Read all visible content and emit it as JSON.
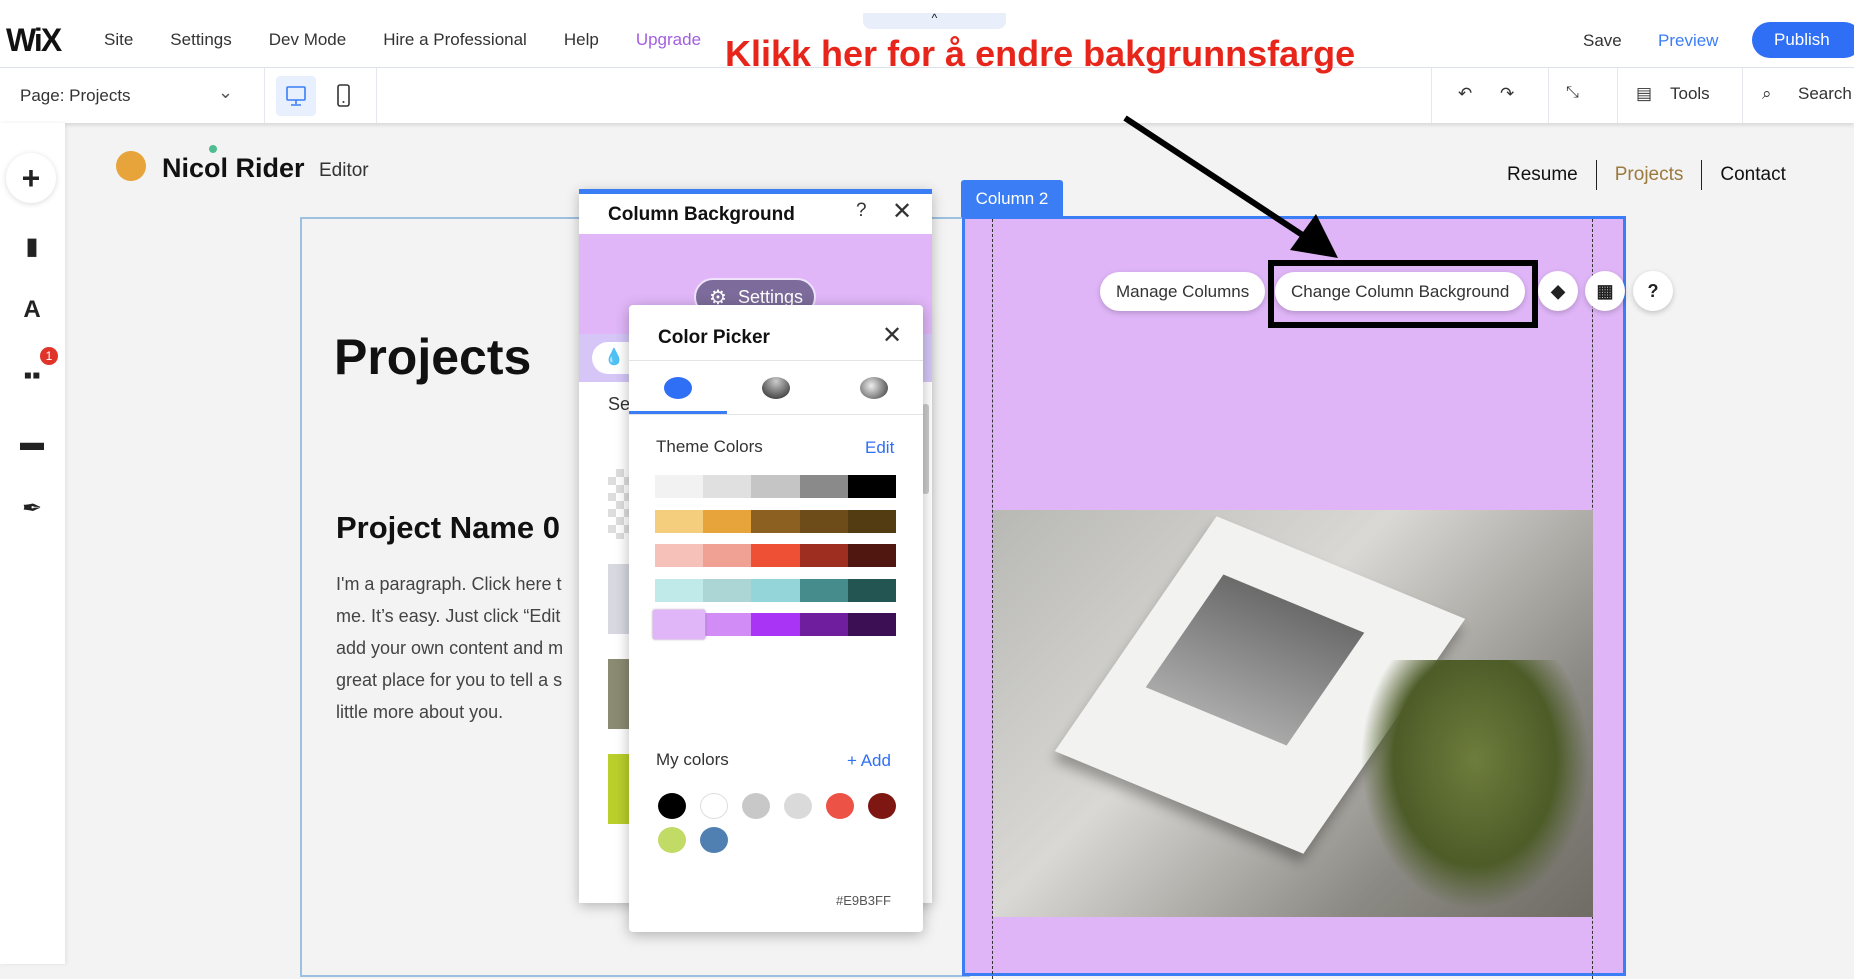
{
  "topbar": {
    "logo": "WiX",
    "menu": [
      "Site",
      "Settings",
      "Dev Mode",
      "Hire a Professional",
      "Help",
      "Upgrade"
    ],
    "save": "Save",
    "preview": "Preview",
    "publish": "Publish",
    "handle": "^"
  },
  "annotation": "Klikk her for å endre bakgrunnsfarge",
  "toolbar": {
    "page": "Page: Projects",
    "tools": "Tools",
    "search": "Search"
  },
  "sidebar": {
    "badge": "1"
  },
  "site": {
    "name": "Nicol Rider",
    "subtitle": "Editor",
    "nav": [
      "Resume",
      "Projects",
      "Contact"
    ],
    "heading": "Projects",
    "project_name": "Project Name 0",
    "paragraph": [
      "I'm a paragraph. Click here t",
      "me. It’s easy. Just click “Edit",
      "add your own content and m",
      "great place for you to tell a s",
      "little more about you."
    ]
  },
  "column": {
    "tab": "Column 2",
    "manage": "Manage Columns",
    "change_bg": "Change Column Background",
    "background_color": "#E0B6F8"
  },
  "column_background": {
    "title": "Column Background",
    "help": "?",
    "close": "✕",
    "settings": "Settings",
    "section_partial": "Se"
  },
  "color_picker": {
    "title": "Color Picker",
    "close": "✕",
    "theme_label": "Theme Colors",
    "edit": "Edit",
    "theme_rows": [
      [
        "#f2f2f2",
        "#e0e0e0",
        "#c5c5c5",
        "#8a8a8a",
        "#000000"
      ],
      [
        "#f4cd7d",
        "#e6a43a",
        "#8b6020",
        "#6d4c19",
        "#533c12"
      ],
      [
        "#f6c1b8",
        "#f1a194",
        "#ee5036",
        "#9e2e20",
        "#501710"
      ],
      [
        "#c0e9e9",
        "#acd6d6",
        "#93d5d9",
        "#468c8c",
        "#235553"
      ],
      [
        "#e0b6f8",
        "#d18cf5",
        "#a934f5",
        "#6f1e9e",
        "#3c0f54"
      ]
    ],
    "selected": [
      4,
      0
    ],
    "my_colors_label": "My colors",
    "add": "+ Add",
    "my_colors": [
      "#000000",
      "#ffffff",
      "#c8c8c8",
      "#dadada",
      "#ec5246",
      "#7e1712",
      "#c2da66",
      "#4f80b1"
    ],
    "hex": "#E9B3FF"
  }
}
